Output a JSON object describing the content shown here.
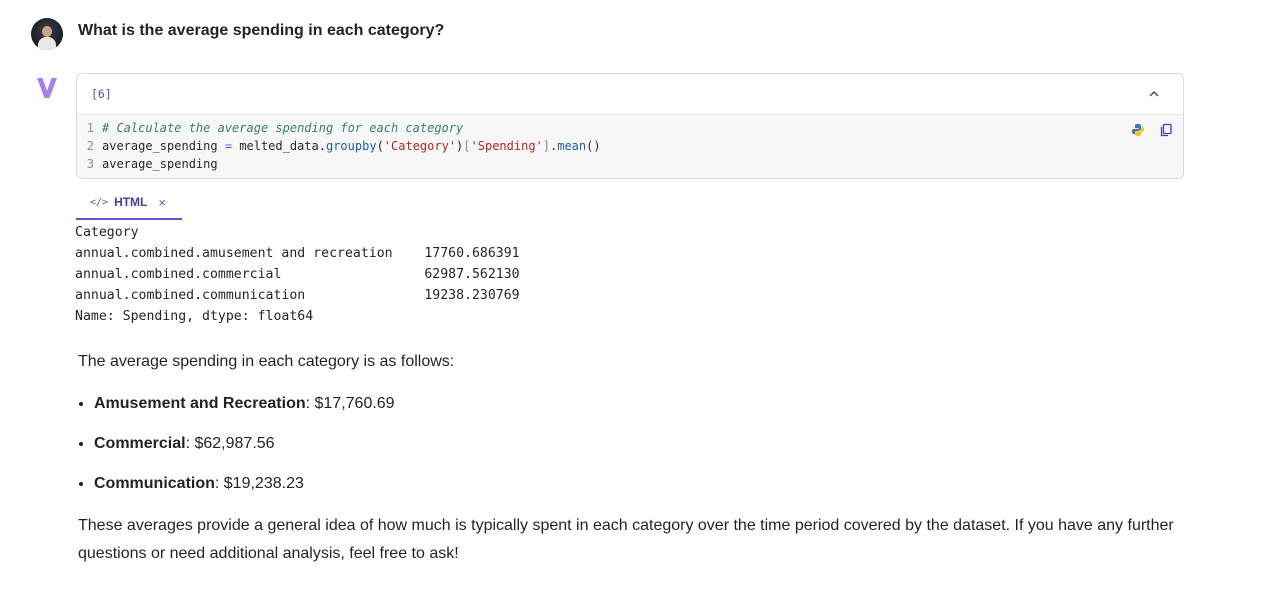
{
  "user": {
    "question": "What is the average spending in each category?"
  },
  "cell": {
    "execution_count": "[6]",
    "code": {
      "lines": [
        {
          "num": "1",
          "comment": "# Calculate the average spending for each category"
        },
        {
          "num": "2",
          "var": "average_spending",
          "op": " = ",
          "obj": "melted_data.",
          "fn1": "groupby",
          "p1": "(",
          "s1": "'Category'",
          "p2": ")",
          "p3": "[",
          "s2": "'Spending'",
          "p4": "]",
          "dot": ".",
          "fn2": "mean",
          "p5": "()"
        },
        {
          "num": "3",
          "var": "average_spending"
        }
      ]
    }
  },
  "output": {
    "tab_label": "HTML",
    "tab_icon": "</>",
    "close_glyph": "×",
    "text": "Category\nannual.combined.amusement and recreation    17760.686391\nannual.combined.commercial                  62987.562130\nannual.combined.communication               19238.230769\nName: Spending, dtype: float64"
  },
  "answer": {
    "intro": "The average spending in each category is as follows:",
    "items": [
      {
        "name": "Amusement and Recreation",
        "value": ": $17,760.69"
      },
      {
        "name": "Commercial",
        "value": ": $62,987.56"
      },
      {
        "name": "Communication",
        "value": ": $19,238.23"
      }
    ],
    "closing": "These averages provide a general idea of how much is typically spent in each category over the time period covered by the dataset. If you have any further questions or need additional analysis, feel free to ask!"
  },
  "colors": {
    "accent": "#6b4fd0",
    "bot_logo": "#a77ff0"
  }
}
